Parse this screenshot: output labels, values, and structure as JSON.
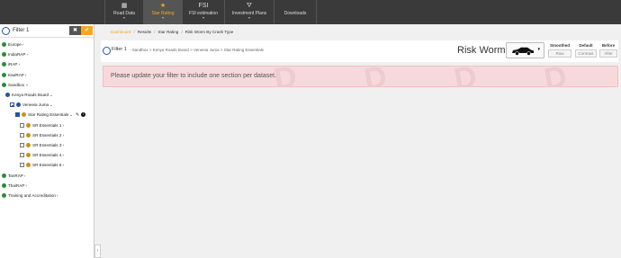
{
  "topnav": {
    "tabs": [
      {
        "label": "Road Data",
        "icon": "grid-icon",
        "glyph": "▦",
        "caret": "▾",
        "active": false
      },
      {
        "label": "Star Rating",
        "icon": "star-icon",
        "glyph": "★",
        "caret": "▾",
        "active": true
      },
      {
        "label": "FSI estimation",
        "icon": "fsi-icon",
        "glyph": "FSI",
        "caret": "▾",
        "active": false
      },
      {
        "label": "Investment Plans",
        "icon": "road-icon",
        "glyph": "⛛",
        "caret": "▾",
        "active": false
      },
      {
        "label": "Downloads",
        "icon": "download-icon",
        "glyph": "",
        "caret": "",
        "active": false
      }
    ]
  },
  "filter": {
    "title": "Filter 1",
    "clear_label": "✖",
    "apply_label": "✔"
  },
  "tree": [
    {
      "label": "Europe",
      "level": 0,
      "dot": "g",
      "check": "none",
      "chev": "›"
    },
    {
      "label": "IndiaRAP",
      "level": 0,
      "dot": "g",
      "check": "none",
      "chev": "›"
    },
    {
      "label": "iRAP",
      "level": 0,
      "dot": "g",
      "check": "none",
      "chev": "›"
    },
    {
      "label": "KiwiRAP",
      "level": 0,
      "dot": "g",
      "check": "none",
      "chev": "›"
    },
    {
      "label": "Sandbox",
      "level": 0,
      "dot": "g",
      "check": "none",
      "chev": "⌄"
    },
    {
      "label": "Kenya Roads Board",
      "level": 1,
      "dot": "b",
      "check": "none",
      "chev": "⌄"
    },
    {
      "label": "Veneeia Juma",
      "level": 2,
      "dot": "b",
      "check": "part",
      "chev": "⌄"
    },
    {
      "label": "Star Rating Essentials",
      "level": 3,
      "dot": "o",
      "check": "on",
      "chev": "⌄",
      "tools": true
    },
    {
      "label": "SR Essentials 1",
      "level": 4,
      "dot": "o",
      "check": "off",
      "chev": "›"
    },
    {
      "label": "SR Essentials 2",
      "level": 4,
      "dot": "o",
      "check": "off",
      "chev": "›"
    },
    {
      "label": "SR Essentials 3",
      "level": 4,
      "dot": "o",
      "check": "off",
      "chev": "›"
    },
    {
      "label": "SR Essentials 4",
      "level": 4,
      "dot": "o",
      "check": "off",
      "chev": "›"
    },
    {
      "label": "SR Essentials 5",
      "level": 4,
      "dot": "o",
      "check": "off",
      "chev": "›"
    },
    {
      "label": "TanRAP",
      "level": 0,
      "dot": "g",
      "check": "none",
      "chev": "›"
    },
    {
      "label": "ThaiRAP",
      "level": 0,
      "dot": "g",
      "check": "none",
      "chev": "›"
    },
    {
      "label": "Training and Accreditation",
      "level": 0,
      "dot": "g",
      "check": "none",
      "chev": "›"
    }
  ],
  "collapse_label": "‹",
  "breadcrumb": [
    "Dashboard",
    "Results",
    "Star Rating",
    "Risk Worm By Crash Type"
  ],
  "card": {
    "filter_title": "Filter 1",
    "filter_path": "- Sandbox > Kenya Roads Board > Veneeia Juma > Star Rating Essentials",
    "report_title": "Risk Worm",
    "vehicle_caret": "▾",
    "options": [
      {
        "title": "Smoothed",
        "button": "Raw"
      },
      {
        "title": "Default",
        "button": "Contrast"
      },
      {
        "title": "Before",
        "button": "After"
      }
    ]
  },
  "alert": {
    "message": "Please update your filter to include one section per dataset."
  },
  "colors": {
    "accent": "#f5a623",
    "topbar": "#3a3a3a",
    "alert_bg": "#f7d9db",
    "brand_blue": "#2552a8",
    "green": "#2e8b3a"
  }
}
